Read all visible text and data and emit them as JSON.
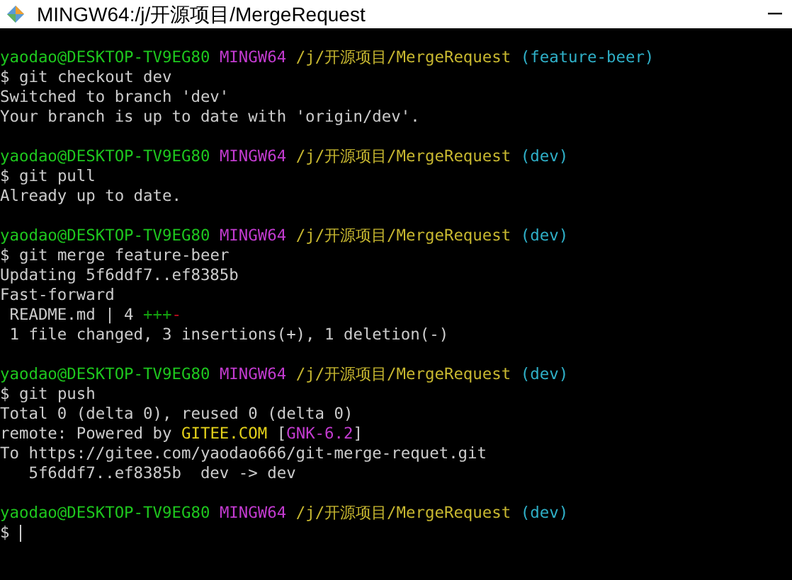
{
  "window": {
    "title": "MINGW64:/j/开源项目/MergeRequest"
  },
  "terminal": {
    "lines": [
      {
        "kind": "blank"
      },
      {
        "kind": "prompt",
        "user": "yaodao@DESKTOP-TV9EG80",
        "system": "MINGW64",
        "path": "/j/开源项目/MergeRequest",
        "branch": "(feature-beer)"
      },
      {
        "kind": "command",
        "symbol": "$",
        "command": "git checkout dev"
      },
      {
        "kind": "output",
        "spans": [
          {
            "kind": "plain",
            "text": "Switched to branch 'dev'"
          }
        ]
      },
      {
        "kind": "output",
        "spans": [
          {
            "kind": "plain",
            "text": "Your branch is up to date with 'origin/dev'."
          }
        ]
      },
      {
        "kind": "blank"
      },
      {
        "kind": "prompt",
        "user": "yaodao@DESKTOP-TV9EG80",
        "system": "MINGW64",
        "path": "/j/开源项目/MergeRequest",
        "branch": "(dev)"
      },
      {
        "kind": "command",
        "symbol": "$",
        "command": "git pull"
      },
      {
        "kind": "output",
        "spans": [
          {
            "kind": "plain",
            "text": "Already up to date."
          }
        ]
      },
      {
        "kind": "blank"
      },
      {
        "kind": "prompt",
        "user": "yaodao@DESKTOP-TV9EG80",
        "system": "MINGW64",
        "path": "/j/开源项目/MergeRequest",
        "branch": "(dev)"
      },
      {
        "kind": "command",
        "symbol": "$",
        "command": "git merge feature-beer"
      },
      {
        "kind": "output",
        "spans": [
          {
            "kind": "plain",
            "text": "Updating 5f6ddf7..ef8385b"
          }
        ]
      },
      {
        "kind": "output",
        "spans": [
          {
            "kind": "plain",
            "text": "Fast-forward"
          }
        ]
      },
      {
        "kind": "output",
        "spans": [
          {
            "kind": "plain",
            "text": " README.md | 4 "
          },
          {
            "kind": "insertions",
            "text": "+++"
          },
          {
            "kind": "deletions",
            "text": "-"
          }
        ]
      },
      {
        "kind": "output",
        "spans": [
          {
            "kind": "plain",
            "text": " 1 file changed, 3 insertions(+), 1 deletion(-)"
          }
        ]
      },
      {
        "kind": "blank"
      },
      {
        "kind": "prompt",
        "user": "yaodao@DESKTOP-TV9EG80",
        "system": "MINGW64",
        "path": "/j/开源项目/MergeRequest",
        "branch": "(dev)"
      },
      {
        "kind": "command",
        "symbol": "$",
        "command": "git push"
      },
      {
        "kind": "output",
        "spans": [
          {
            "kind": "plain",
            "text": "Total 0 (delta 0), reused 0 (delta 0)"
          }
        ]
      },
      {
        "kind": "output",
        "spans": [
          {
            "kind": "plain",
            "text": "remote: Powered by "
          },
          {
            "kind": "highlight",
            "text": "GITEE.COM"
          },
          {
            "kind": "plain",
            "text": " ["
          },
          {
            "kind": "tag",
            "text": "GNK-6.2"
          },
          {
            "kind": "plain",
            "text": "]"
          }
        ]
      },
      {
        "kind": "output",
        "spans": [
          {
            "kind": "plain",
            "text": "To https://gitee.com/yaodao666/git-merge-requet.git"
          }
        ]
      },
      {
        "kind": "output",
        "spans": [
          {
            "kind": "plain",
            "text": "   5f6ddf7..ef8385b  dev -> dev"
          }
        ]
      },
      {
        "kind": "blank"
      },
      {
        "kind": "prompt",
        "user": "yaodao@DESKTOP-TV9EG80",
        "system": "MINGW64",
        "path": "/j/开源项目/MergeRequest",
        "branch": "(dev)"
      },
      {
        "kind": "command",
        "symbol": "$",
        "cursor": true
      }
    ]
  }
}
